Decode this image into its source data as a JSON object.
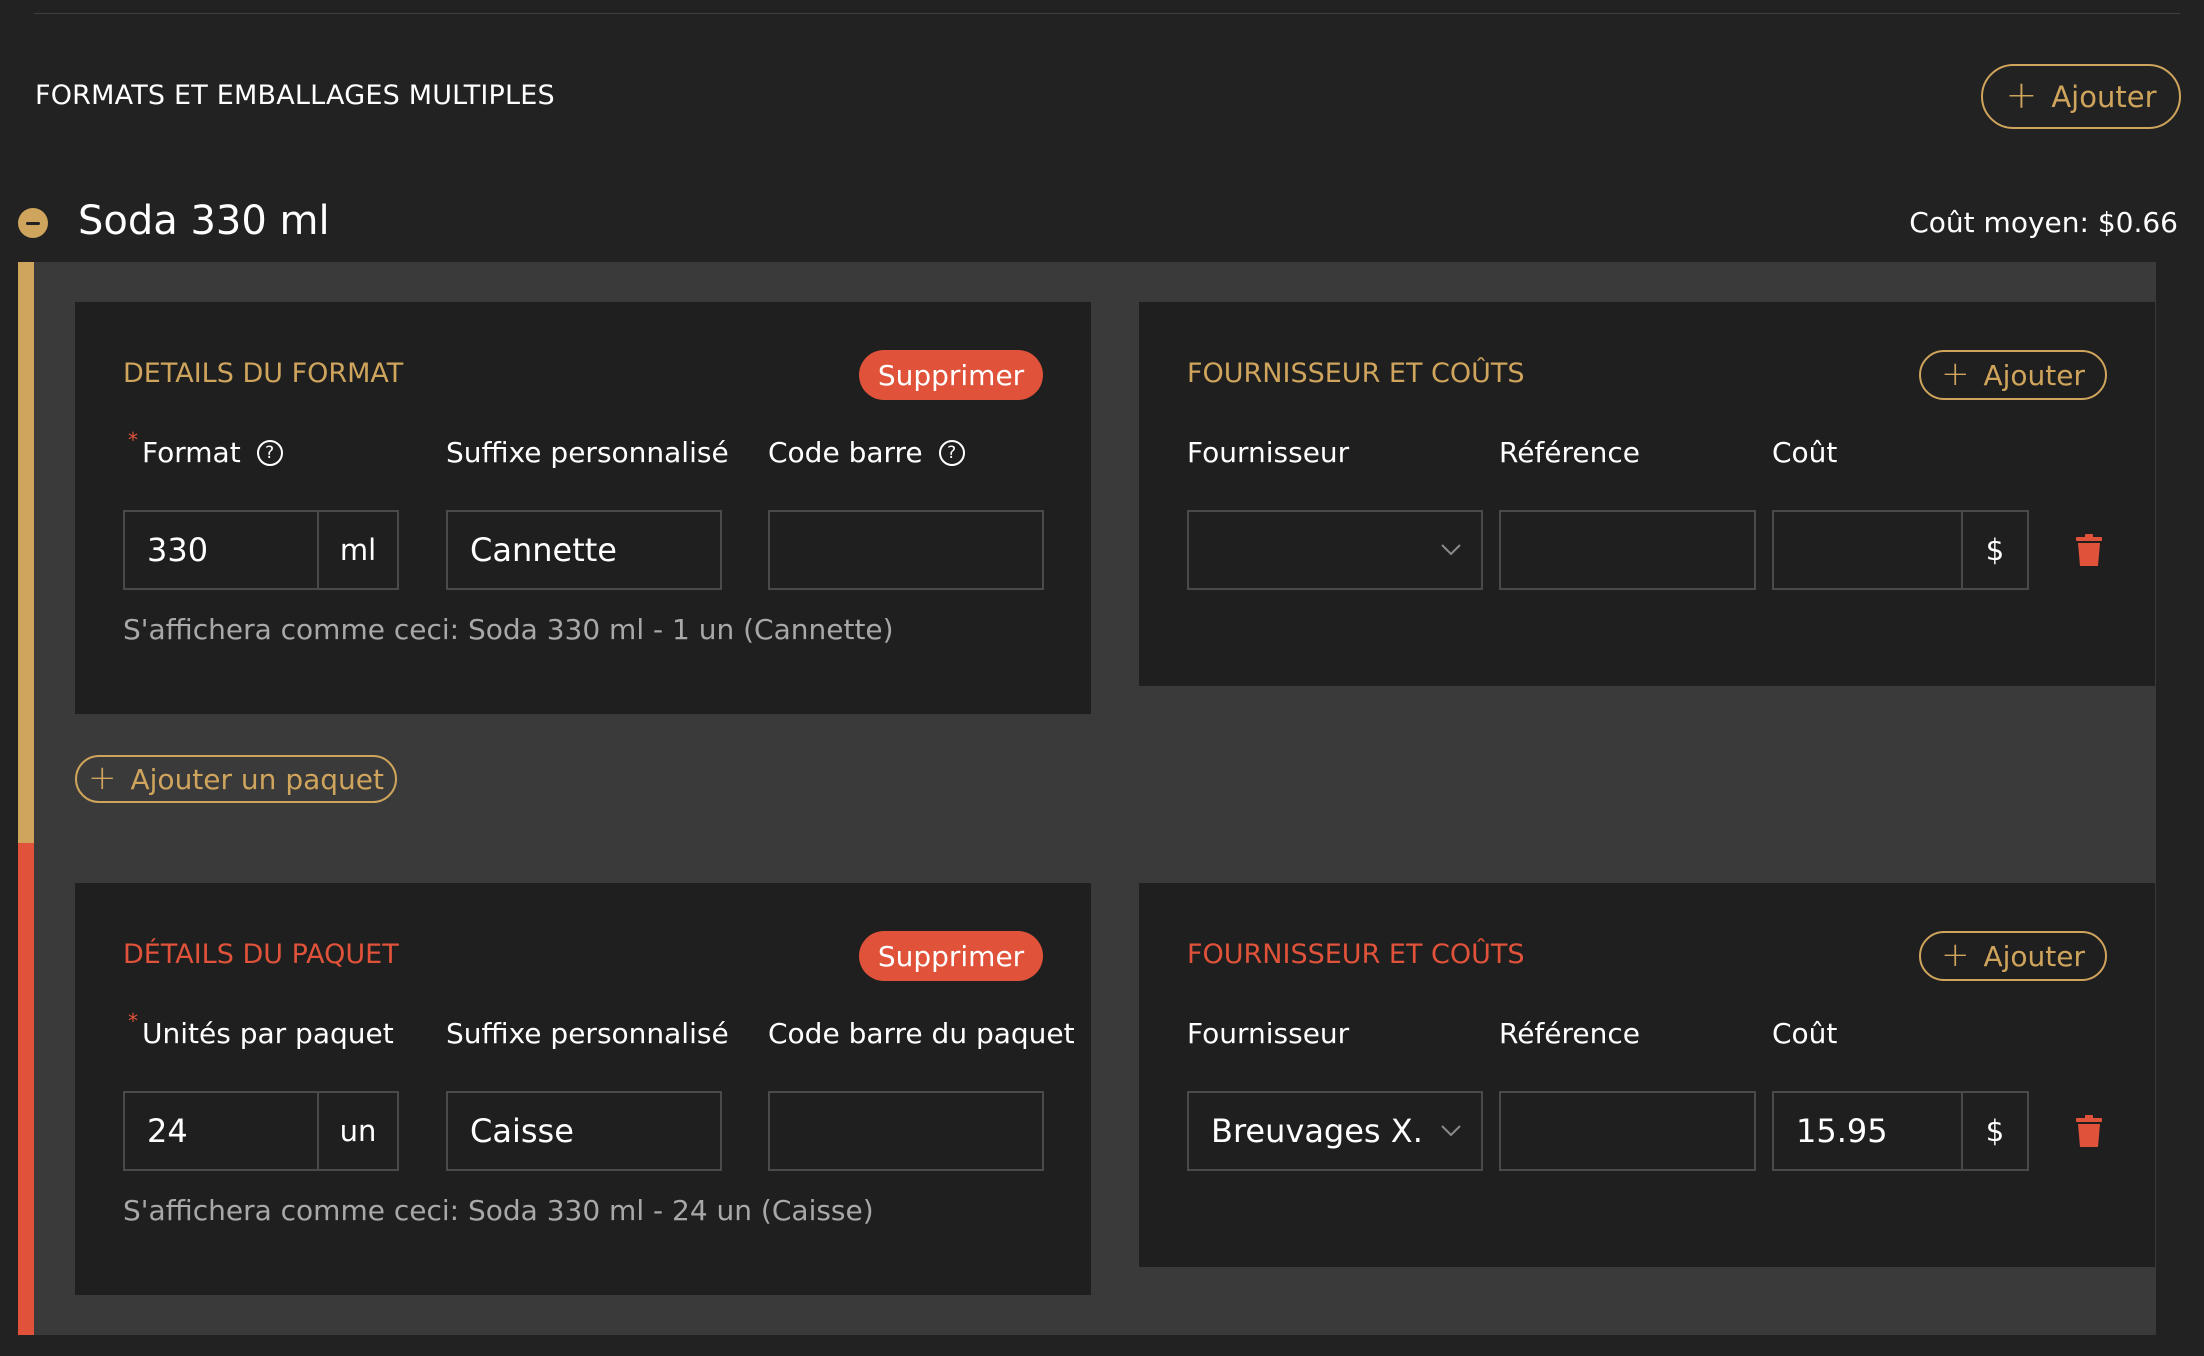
{
  "section": {
    "title": "FORMATS ET EMBALLAGES MULTIPLES",
    "add_label": "Ajouter"
  },
  "format": {
    "name": "Soda 330 ml",
    "avg_cost": "Coût moyen: $0.66"
  },
  "format_details": {
    "title": "DETAILS DU FORMAT",
    "delete_label": "Supprimer",
    "format_label": "Format",
    "format_value": "330",
    "format_unit": "ml",
    "suffix_label": "Suffixe personnalisé",
    "suffix_value": "Cannette",
    "barcode_label": "Code barre",
    "barcode_value": "",
    "preview": "S'affichera comme ceci: Soda 330 ml - 1 un (Cannette)"
  },
  "format_supplier": {
    "title": "FOURNISSEUR ET COÛTS",
    "add_label": "Ajouter",
    "supplier_label": "Fournisseur",
    "supplier_value": "",
    "reference_label": "Référence",
    "reference_value": "",
    "cost_label": "Coût",
    "cost_value": "",
    "currency": "$"
  },
  "add_package_label": "Ajouter un paquet",
  "package_details": {
    "title": "DÉTAILS DU PAQUET",
    "delete_label": "Supprimer",
    "units_label": "Unités par paquet",
    "units_value": "24",
    "units_unit": "un",
    "suffix_label": "Suffixe personnalisé",
    "suffix_value": "Caisse",
    "barcode_label": "Code barre du paquet",
    "barcode_value": "",
    "preview": "S'affichera comme ceci: Soda 330 ml - 24 un (Caisse)"
  },
  "package_supplier": {
    "title": "FOURNISSEUR ET COÛTS",
    "add_label": "Ajouter",
    "supplier_label": "Fournisseur",
    "supplier_value": "Breuvages X...",
    "reference_label": "Référence",
    "reference_value": "",
    "cost_label": "Coût",
    "cost_value": "15.95",
    "currency": "$"
  },
  "colors": {
    "background": "#222222",
    "panel": "#3a3a3a",
    "card": "#1f1f1f",
    "accent_gold": "#cfa45c",
    "accent_red": "#e0533a"
  },
  "icons": {
    "plus": "plus-icon",
    "collapse": "minus-circle-icon",
    "help": "question-circle-icon",
    "chevron": "chevron-down-icon",
    "trash": "trash-icon"
  }
}
